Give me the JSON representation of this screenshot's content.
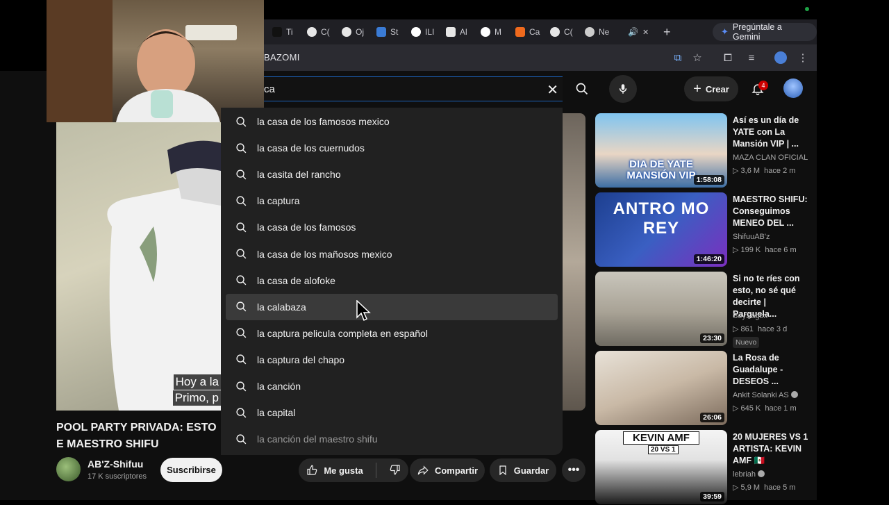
{
  "browser": {
    "tabs": [
      {
        "label": "Ti",
        "icon": "tiktok-icon",
        "color": "#111111"
      },
      {
        "label": "C(",
        "icon": "chatgpt-icon",
        "color": "#e6e6e6"
      },
      {
        "label": "Oj",
        "icon": "chatgpt-icon",
        "color": "#e6e6e6"
      },
      {
        "label": "St",
        "icon": "steam-icon",
        "color": "#3a7bd5"
      },
      {
        "label": "ILI",
        "icon": "google-icon",
        "color": "#ffffff"
      },
      {
        "label": "Al",
        "icon": "dark-app-icon",
        "color": "#e6e6e6"
      },
      {
        "label": "M",
        "icon": "google-icon",
        "color": "#ffffff"
      },
      {
        "label": "Ca",
        "icon": "orange-app-icon",
        "color": "#f06a1d"
      },
      {
        "label": "C(",
        "icon": "chatgpt-icon",
        "color": "#e6e6e6"
      },
      {
        "label": "Ne",
        "icon": "chrome-icon",
        "color": "#cccccc"
      }
    ],
    "active_tab_audio_icon": "speaker-icon",
    "close_glyph": "✕",
    "new_tab_glyph": "+",
    "gemini_label": "Pregúntale a Gemini",
    "address_text": "BAZOMI"
  },
  "youtube": {
    "search_value": "ca",
    "create_label": "Crear",
    "notification_count": "4",
    "suggestions": [
      "la casa de los famosos mexico",
      "la casa de los cuernudos",
      "la casita del rancho",
      "la captura",
      "la casa de los famosos",
      "la casa de los mañosos mexico",
      "la casa de alofoke",
      "la calabaza",
      "la captura pelicula completa en español",
      "la captura del chapo",
      "la canción",
      "la capital",
      "la canción del maestro shifu"
    ],
    "highlighted_index": 7,
    "caption_lines": [
      "Hoy a la",
      "Primo, p"
    ],
    "video_title": "POOL PARTY PRIVADA: ESTO E MAESTRO SHIFU",
    "channel_name": "AB'Z-Shifuu",
    "channel_subs": "17 K suscriptores",
    "subscribe_label": "Suscribirse",
    "actions": {
      "like": "Me gusta",
      "share": "Compartir",
      "save": "Guardar"
    },
    "recommendations": [
      {
        "title": "Así es un día de YATE con La Mansión VIP | ...",
        "channel": "MAZA CLAN OFICIAL",
        "views": "3,6 M",
        "age": "hace 2 m",
        "duration": "1:58:08",
        "thumb_text": "DIA DE YATE MANSIÓN VIP",
        "verified": false,
        "badge": ""
      },
      {
        "title": "MAESTRO SHIFU: Conseguimos MENEO DEL ...",
        "channel": "ShifuuAB'z",
        "views": "199 K",
        "age": "hace 6 m",
        "duration": "1:46:20",
        "thumb_text": "ANTRO MO REY",
        "verified": false,
        "badge": ""
      },
      {
        "title": "Si no te ríes con esto, no sé qué decirte | Parguela...",
        "channel": "SoySagox",
        "views": "861",
        "age": "hace 3 d",
        "duration": "23:30",
        "thumb_text": "",
        "verified": false,
        "badge": "Nuevo"
      },
      {
        "title": "La Rosa de Guadalupe - DESEOS ...",
        "channel": "Ankit Solanki AS",
        "views": "645 K",
        "age": "hace 1 m",
        "duration": "26:06",
        "thumb_text": "",
        "verified": true,
        "badge": ""
      },
      {
        "title": "20 MUJERES VS 1 ARTISTA: KEVIN AMF 🇲🇽",
        "channel": "lebriah",
        "views": "5,9 M",
        "age": "hace 5 m",
        "duration": "39:59",
        "thumb_text": "KEVIN AMF",
        "thumb_sub": "20 VS 1",
        "verified": true,
        "badge": ""
      }
    ]
  }
}
